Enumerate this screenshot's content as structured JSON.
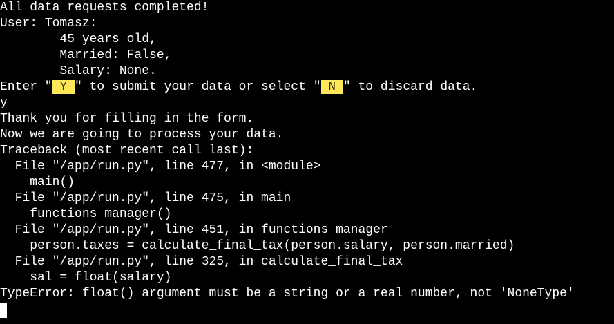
{
  "terminal": {
    "lines": [
      "All data requests completed!",
      "User: Tomasz:",
      "        45 years old,",
      "        Married: False,",
      "        Salary: None."
    ],
    "prompt": {
      "pre": "Enter \"",
      "yes_key": " Y ",
      "mid": "\" to submit your data or select \"",
      "no_key": " N ",
      "post": "\" to discard data."
    },
    "user_input": "y",
    "lines_after": [
      "Thank you for filling in the form.",
      "Now we are going to process your data.",
      "Traceback (most recent call last):",
      "  File \"/app/run.py\", line 477, in <module>",
      "    main()",
      "  File \"/app/run.py\", line 475, in main",
      "    functions_manager()",
      "  File \"/app/run.py\", line 451, in functions_manager",
      "    person.taxes = calculate_final_tax(person.salary, person.married)",
      "  File \"/app/run.py\", line 325, in calculate_final_tax",
      "    sal = float(salary)",
      "TypeError: float() argument must be a string or a real number, not 'NoneType'"
    ]
  },
  "colors": {
    "background": "#000000",
    "text": "#ffffff",
    "highlight": "#ffe75a"
  }
}
